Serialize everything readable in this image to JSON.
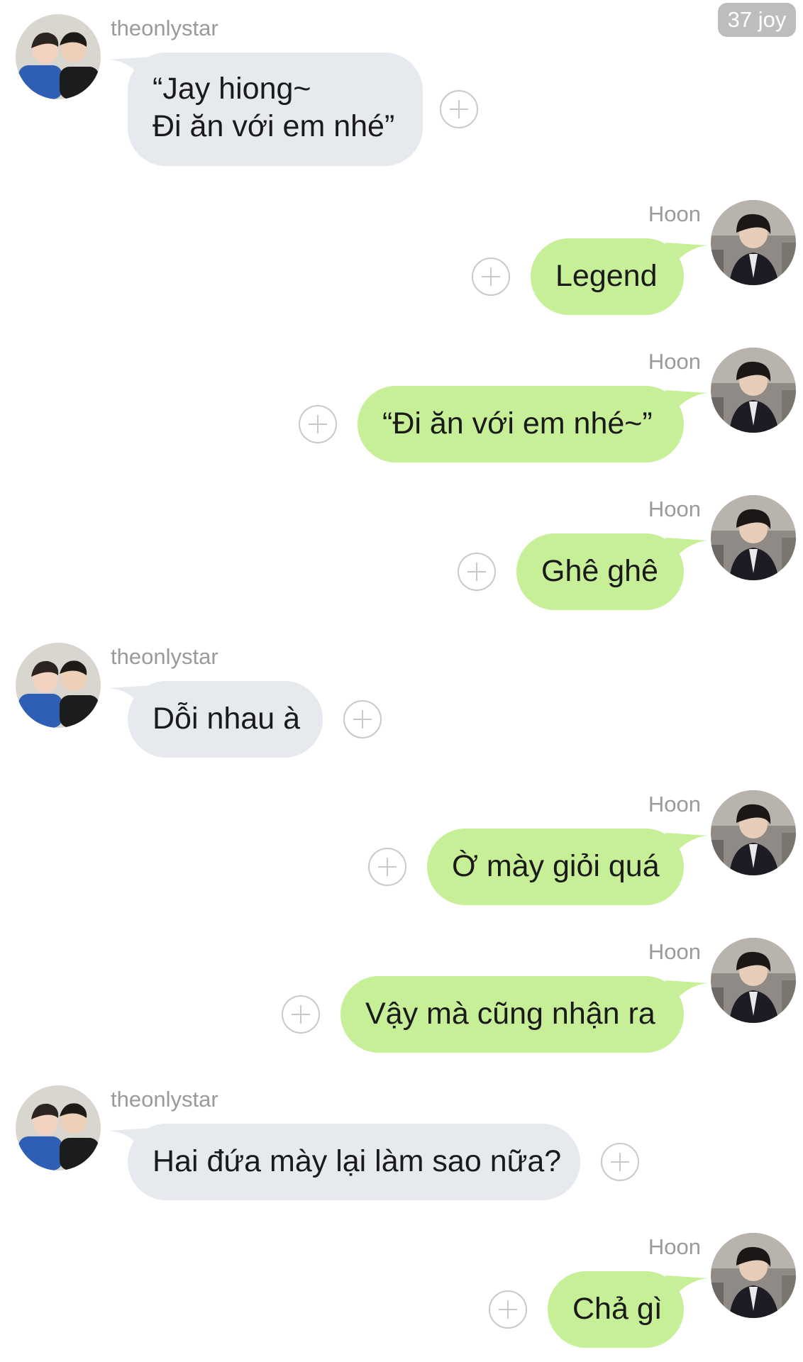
{
  "header": {
    "badge": "37 joy"
  },
  "messages": [
    {
      "sender": "theonlystar",
      "side": "in",
      "text": "“Jay hiong~\nĐi ăn với em nhé”"
    },
    {
      "sender": "Hoon",
      "side": "out",
      "text": "Legend"
    },
    {
      "sender": "Hoon",
      "side": "out",
      "text": "“Đi ăn với em nhé~”"
    },
    {
      "sender": "Hoon",
      "side": "out",
      "text": "Ghê ghê"
    },
    {
      "sender": "theonlystar",
      "side": "in",
      "text": "Dỗi nhau à"
    },
    {
      "sender": "Hoon",
      "side": "out",
      "text": "Ờ mày giỏi quá"
    },
    {
      "sender": "Hoon",
      "side": "out",
      "text": "Vậy mà cũng nhận ra"
    },
    {
      "sender": "theonlystar",
      "side": "in",
      "text": "Hai đứa mày lại làm sao nữa?"
    },
    {
      "sender": "Hoon",
      "side": "out",
      "text": "Chả gì"
    }
  ],
  "colors": {
    "incoming_bubble": "#e6e9ee",
    "outgoing_bubble": "#c7ef97",
    "sender_name": "#9a9a9a",
    "badge": "#bdbdbd"
  }
}
